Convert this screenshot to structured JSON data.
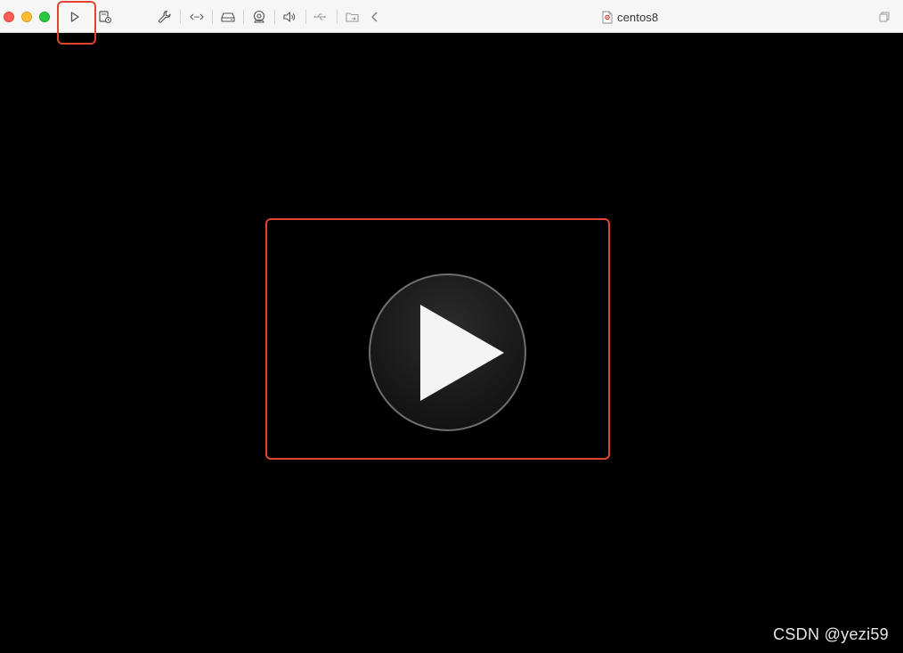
{
  "window": {
    "title": "centos8"
  },
  "toolbar": {
    "items": [
      {
        "name": "start-vm",
        "icon": "play-icon"
      },
      {
        "name": "snapshot",
        "icon": "snapshot-icon"
      },
      {
        "name": "settings",
        "icon": "wrench-icon"
      },
      {
        "name": "network",
        "icon": "network-icon"
      },
      {
        "name": "disk",
        "icon": "disk-icon"
      },
      {
        "name": "camera",
        "icon": "camera-icon"
      },
      {
        "name": "sound",
        "icon": "speaker-icon"
      },
      {
        "name": "usb",
        "icon": "usb-icon"
      },
      {
        "name": "shared-folder",
        "icon": "shared-folder-icon"
      },
      {
        "name": "collapse",
        "icon": "chevron-left-icon"
      }
    ],
    "right_icon": "window-restore-icon"
  },
  "main": {
    "play_button_icon": "large-play-icon"
  },
  "watermark": {
    "text": "CSDN @yezi59"
  },
  "colors": {
    "highlight": "#e2432f",
    "titlebar_bg": "#f6f6f6",
    "vm_bg": "#000000",
    "close": "#fe5f57",
    "minimize": "#febc2e",
    "zoom": "#28c840"
  }
}
